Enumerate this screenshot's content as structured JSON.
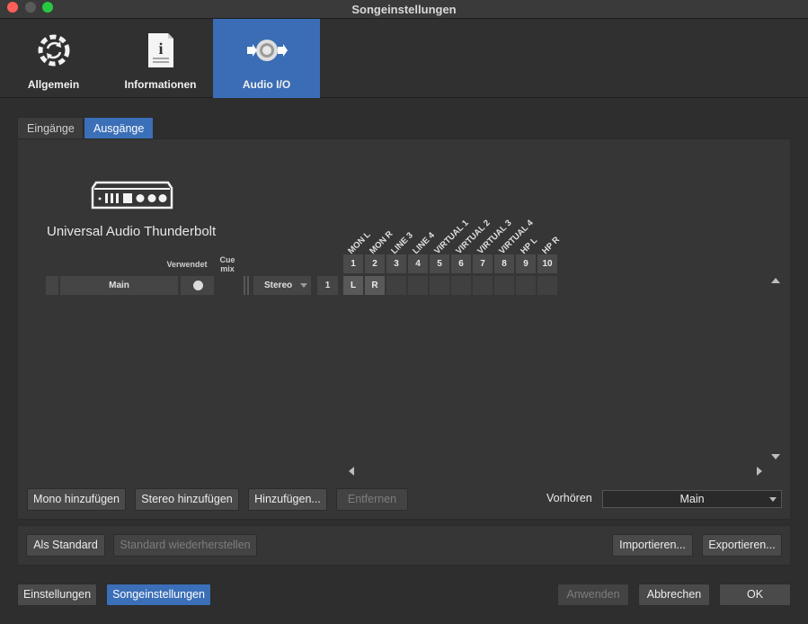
{
  "window": {
    "title": "Songeinstellungen"
  },
  "top_tabs": [
    {
      "label": "Allgemein",
      "icon": "sync-gear-icon"
    },
    {
      "label": "Informationen",
      "icon": "info-document-icon"
    },
    {
      "label": "Audio I/O",
      "icon": "audio-io-icon"
    }
  ],
  "active_top_tab": "Audio I/O",
  "sub_tabs": [
    {
      "label": "Eingänge"
    },
    {
      "label": "Ausgänge"
    }
  ],
  "active_sub_tab": "Ausgänge",
  "device": {
    "name": "Universal Audio Thunderbolt",
    "icon": "audio-interface-icon"
  },
  "columns": {
    "used": "Verwendet",
    "cue_mix": "Cue mix"
  },
  "ports": [
    {
      "name": "MON L",
      "number": "1"
    },
    {
      "name": "MON R",
      "number": "2"
    },
    {
      "name": "LINE 3",
      "number": "3"
    },
    {
      "name": "LINE 4",
      "number": "4"
    },
    {
      "name": "VIRTUAL 1",
      "number": "5"
    },
    {
      "name": "VIRTUAL 2",
      "number": "6"
    },
    {
      "name": "VIRTUAL 3",
      "number": "7"
    },
    {
      "name": "VIRTUAL 4",
      "number": "8"
    },
    {
      "name": "HP L",
      "number": "9"
    },
    {
      "name": "HP R",
      "number": "10"
    }
  ],
  "channel_row": {
    "name": "Main",
    "used": true,
    "format": "Stereo",
    "channel": "1",
    "assignments": [
      "L",
      "R",
      "",
      "",
      "",
      "",
      "",
      "",
      "",
      ""
    ]
  },
  "buttons": {
    "add_mono": "Mono hinzufügen",
    "add_stereo": "Stereo hinzufügen",
    "add": "Hinzufügen...",
    "remove": "Entfernen",
    "set_default": "Als Standard",
    "restore_default": "Standard wiederherstellen",
    "import": "Importieren...",
    "export": "Exportieren...",
    "settings": "Einstellungen",
    "song_settings": "Songeinstellungen",
    "apply": "Anwenden",
    "cancel": "Abbrechen",
    "ok": "OK"
  },
  "preview": {
    "label": "Vorhören",
    "value": "Main"
  },
  "colors": {
    "accent": "#3b6fb8"
  }
}
